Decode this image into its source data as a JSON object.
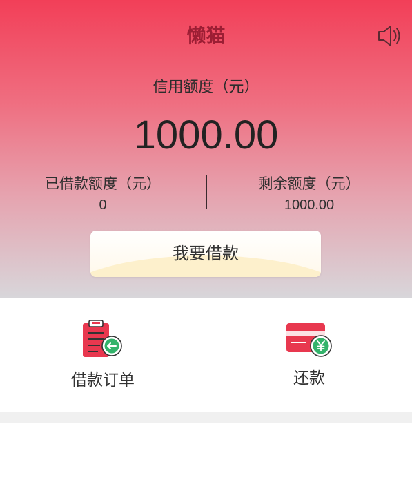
{
  "header": {
    "title": "懒猫",
    "speaker_icon": "speaker-icon"
  },
  "credit": {
    "label": "信用额度（元）",
    "amount": "1000.00"
  },
  "stats": {
    "borrowed_label": "已借款额度（元）",
    "borrowed_value": "0",
    "remaining_label": "剩余额度（元）",
    "remaining_value": "1000.00"
  },
  "borrow_button": {
    "label": "我要借款"
  },
  "actions": [
    {
      "label": "借款订单",
      "icon": "clipboard-order-icon"
    },
    {
      "label": "还款",
      "icon": "card-yuan-icon"
    }
  ],
  "colors": {
    "brand_red": "#f23f58",
    "title_dark_red": "#9c1e34",
    "icon_red": "#e8384f",
    "icon_green": "#33b36b"
  }
}
